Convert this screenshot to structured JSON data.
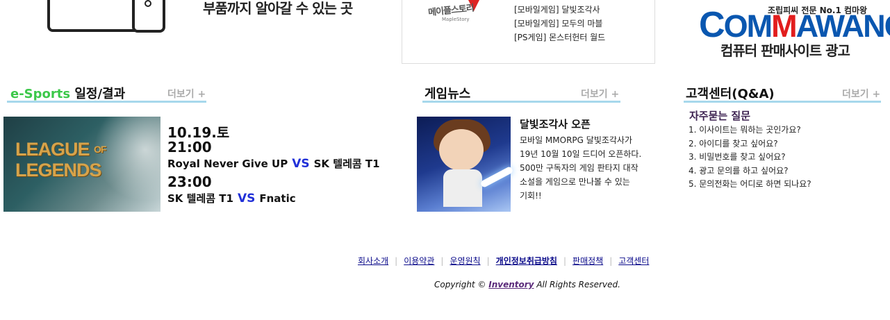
{
  "top_banner": {
    "pc_text": "부품까지 알아갈 수 있는 곳"
  },
  "game_promo": {
    "logo_text": "메이플스토리",
    "logo_sub": "MapleStory",
    "items": [
      "[모바일게임] 달빛조각사",
      "[모바일게임] 모두의 마블",
      "[PS게임] 몬스터헌터 월드"
    ]
  },
  "commawang": {
    "tagline": "조립피씨 전문 No.1 컴마왕",
    "logo_c": "C",
    "logo_om": "OM",
    "logo_m": "M",
    "logo_awang": "AWANG",
    "ad_text": "컴퓨터 판매사이트 광고"
  },
  "esports": {
    "title_green": "e-Sports",
    "title_rest": " 일정/결과",
    "more_label": "더보기 +",
    "image_text_line1": "LEAGUE",
    "image_text_of": "OF",
    "image_text_line2": "LEGENDS",
    "date": "10.19.토",
    "matches": [
      {
        "time": "21:00",
        "team_a": "Royal Never Give UP",
        "vs": "VS",
        "team_b": "SK 텔레콤 T1"
      },
      {
        "time": "23:00",
        "team_a": "SK 텔레콤 T1",
        "vs": "VS",
        "team_b": "Fnatic"
      }
    ]
  },
  "news": {
    "title": "게임뉴스",
    "more_label": "더보기 +",
    "headline": "달빛조각사 오픈",
    "body_lines": [
      "모바일 MMORPG 달빛조각사가",
      "19년 10월 10일 드디어 오픈하다.",
      "500만 구독자의 게임 판타지 대작",
      "소설을 게임으로 만나볼 수 있는",
      "기회!!"
    ]
  },
  "support": {
    "title": "고객센터(Q&A)",
    "more_label": "더보기 +",
    "faq_title": "자주묻는 질문",
    "faq_items": [
      "1. 이사이트는 뭐하는 곳인가요?",
      "2. 아이디를 찾고 싶어요?",
      "3. 비밀번호를 찾고 싶어요?",
      "4. 광고 문의를 하고 싶어요?",
      "5. 문의전화는 어디로 하면 되나요?"
    ]
  },
  "footer": {
    "links": [
      "회사소개",
      "이용약관",
      "운영원칙",
      "개인정보취급방침",
      "판매정책",
      "고객센터"
    ],
    "copyright_prefix": "Copyright © ",
    "copyright_brand": "Inventory",
    "copyright_suffix": " All Rights Reserved."
  }
}
